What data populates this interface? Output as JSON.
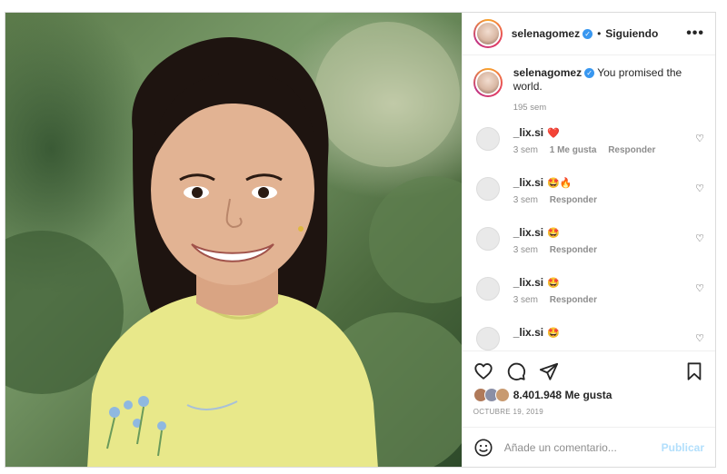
{
  "post": {
    "photo_icon": "portrait-photo",
    "author": "selenagomez",
    "verified_icon": "verified-badge-icon",
    "follow_separator": "•",
    "follow_status": "Siguiendo",
    "more_icon": "more-options-icon",
    "more_label": "•••",
    "caption_text": "You promised the world.",
    "caption_time": "195 sem"
  },
  "comments": [
    {
      "user": "_lix.si",
      "emoji": "❤️",
      "time": "3 sem",
      "likes": "1 Me gusta",
      "reply": "Responder"
    },
    {
      "user": "_lix.si",
      "emoji": "🤩🔥",
      "time": "3 sem",
      "likes": "",
      "reply": "Responder"
    },
    {
      "user": "_lix.si",
      "emoji": "🤩",
      "time": "3 sem",
      "likes": "",
      "reply": "Responder"
    },
    {
      "user": "_lix.si",
      "emoji": "🤩",
      "time": "3 sem",
      "likes": "",
      "reply": "Responder"
    },
    {
      "user": "_lix.si",
      "emoji": "🤩",
      "time": "",
      "likes": "",
      "reply": ""
    }
  ],
  "actions": {
    "like_count": "8.401.948 Me gusta",
    "date": "OCTUBRE 19, 2019"
  },
  "add_comment": {
    "placeholder": "Añade un comentario...",
    "post_label": "Publicar"
  },
  "colors": {
    "accent_blue": "#3897f0",
    "post_disabled": "#b2dffc",
    "border": "#efefef",
    "muted_text": "#8e8e8e"
  }
}
